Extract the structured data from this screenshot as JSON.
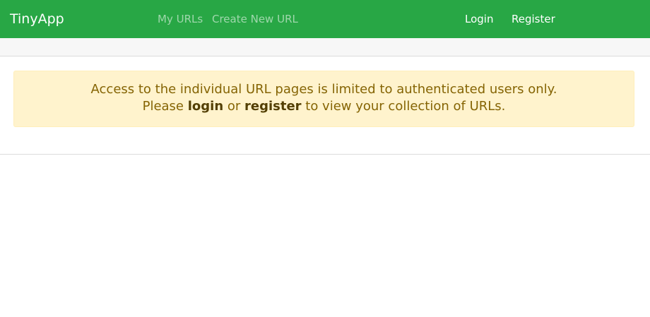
{
  "navbar": {
    "brand": "TinyApp",
    "links": {
      "my_urls": "My URLs",
      "create_new_url": "Create New URL",
      "login": "Login",
      "register": "Register"
    }
  },
  "alert": {
    "line1": "Access to the individual URL pages is limited to authenticated users only.",
    "line2_prefix": "Please ",
    "login_link": "login",
    "line2_mid": " or ",
    "register_link": "register",
    "line2_suffix": " to view your collection of URLs."
  },
  "colors": {
    "navbar_bg": "#28a745",
    "alert_bg": "#fff3cd",
    "alert_text": "#856404"
  }
}
